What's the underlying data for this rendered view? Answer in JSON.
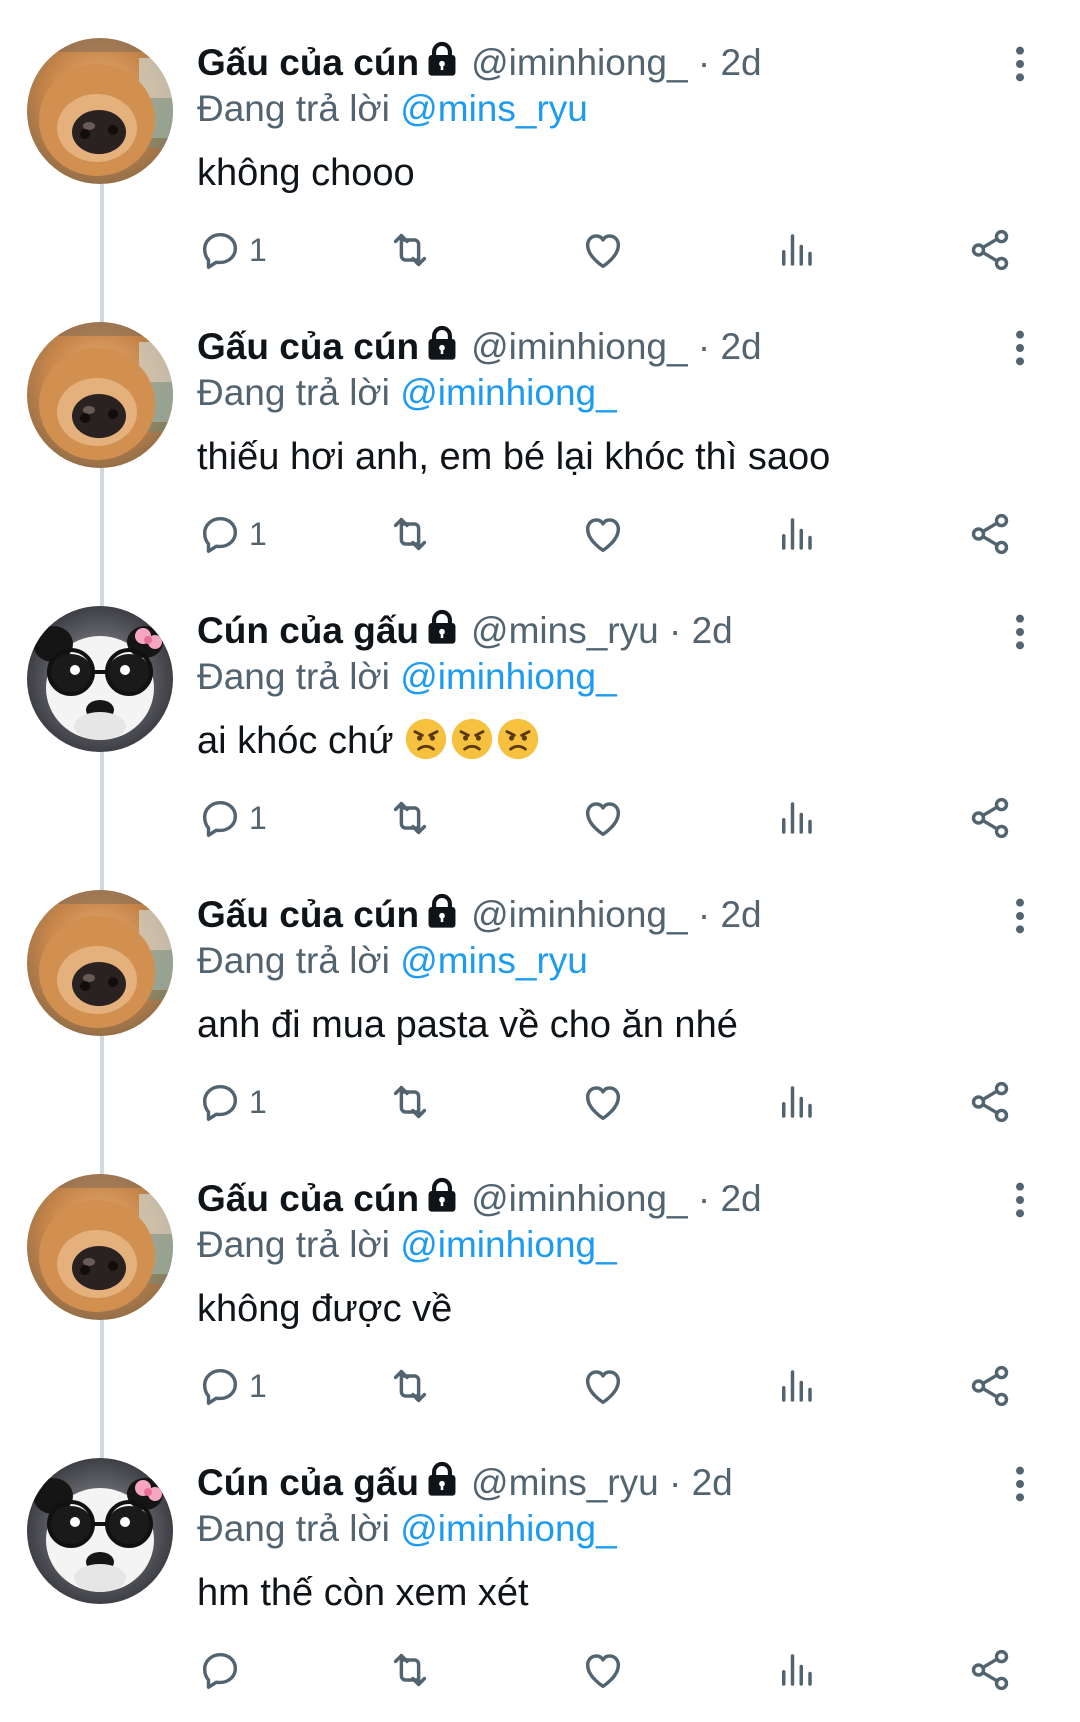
{
  "colors": {
    "name": "#0f1419",
    "secondary": "#536471",
    "link": "#1d9bf0",
    "thread_line": "#cfd9de",
    "icon": "#536471"
  },
  "reply_prefix": "Đang trả lời",
  "tweets": [
    {
      "author": "Gấu của cún",
      "handle": "@iminhiong_",
      "separator": "·",
      "time": "2d",
      "replying_to": "@mins_ryu",
      "text": "không chooo",
      "reply_count": "1",
      "avatar": "dog-avatar"
    },
    {
      "author": "Gấu của cún",
      "handle": "@iminhiong_",
      "separator": "·",
      "time": "2d",
      "replying_to": "@iminhiong_",
      "text": "thiếu hơi anh, em bé lại khóc thì saoo",
      "reply_count": "1",
      "avatar": "dog-avatar"
    },
    {
      "author": "Cún của gấu",
      "handle": "@mins_ryu",
      "separator": "·",
      "time": "2d",
      "replying_to": "@iminhiong_",
      "text": "ai khóc chứ",
      "emojis": "😠😠😠",
      "reply_count": "1",
      "avatar": "panda-avatar"
    },
    {
      "author": "Gấu của cún",
      "handle": "@iminhiong_",
      "separator": "·",
      "time": "2d",
      "replying_to": "@mins_ryu",
      "text": "anh đi mua pasta về cho ăn nhé",
      "reply_count": "1",
      "avatar": "dog-avatar"
    },
    {
      "author": "Gấu của cún",
      "handle": "@iminhiong_",
      "separator": "·",
      "time": "2d",
      "replying_to": "@iminhiong_",
      "text": "không được về",
      "reply_count": "1",
      "avatar": "dog-avatar"
    },
    {
      "author": "Cún của gấu",
      "handle": "@mins_ryu",
      "separator": "·",
      "time": "2d",
      "replying_to": "@iminhiong_",
      "text": "hm thế còn xem xét",
      "reply_count": "",
      "avatar": "panda-avatar"
    }
  ]
}
